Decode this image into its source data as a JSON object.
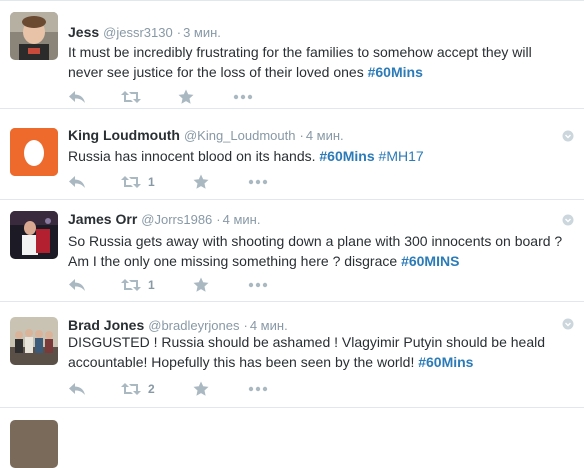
{
  "tweets": [
    {
      "name": "Jess",
      "handle": "@jessr3130",
      "time": "3 мин.",
      "text_before": "It must be incredibly frustrating for the families to somehow accept they will never see justice for the loss of their loved ones ",
      "hashtags": [
        "#60Mins"
      ],
      "retweets": "",
      "avatar": "photo-child"
    },
    {
      "name": "King Loudmouth",
      "handle": "@King_Loudmouth",
      "time": "4 мин.",
      "text_before": "Russia has innocent blood on its hands. ",
      "hashtags": [
        "#60Mins",
        "#MH17"
      ],
      "retweets": "1",
      "avatar": "default-egg"
    },
    {
      "name": "James Orr",
      "handle": "@Jorrs1986",
      "time": "4 мин.",
      "text_before": "So Russia gets away with shooting down a plane with 300 innocents on board ? Am I the only one missing something here ? disgrace ",
      "hashtags": [
        "#60MINS"
      ],
      "retweets": "1",
      "avatar": "photo-stage"
    },
    {
      "name": "Brad Jones",
      "handle": "@bradleyrjones",
      "time": "4 мин.",
      "text_before": "DISGUSTED ! Russia should be ashamed ! Vlagyimir Putyin should be heald accountable! Hopefully this has been seen by the world! ",
      "hashtags": [
        "#60Mins"
      ],
      "retweets": "2",
      "avatar": "photo-group"
    }
  ],
  "colors": {
    "name": "#292f33",
    "meta": "#8899a6",
    "hashtag": "#2b7bb9",
    "egg_bg": "#ee6a2c",
    "divider": "#e1e8ed",
    "action_icon": "#aab8c2"
  },
  "icons": [
    "reply-icon",
    "retweet-icon",
    "favorite-icon",
    "more-icon",
    "caret-icon"
  ]
}
